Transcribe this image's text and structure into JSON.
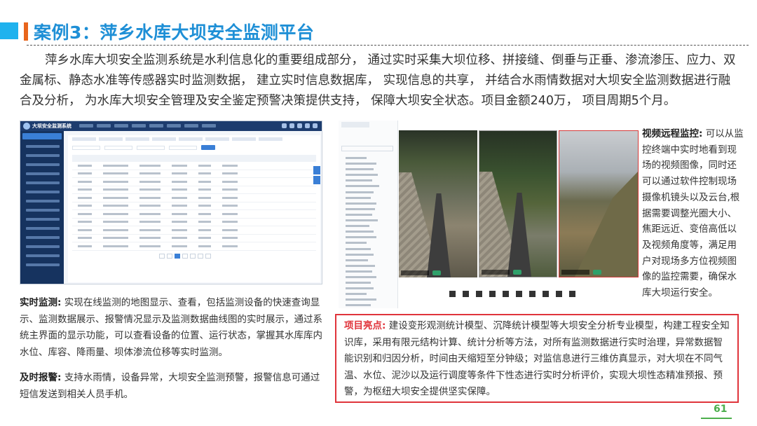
{
  "title": "案例3：萍乡水库大坝安全监测平台",
  "intro": "萍乡水库大坝安全监测系统是水利信息化的重要组成部分， 通过实时采集大坝位移、拼接缝、倒垂与正垂、渗流渗压、应力、双金属标、静态水准等传感器实时监测数据， 建立实时信息数据库， 实现信息的共享， 并结合水雨情数据对大坝安全监测数据进行融合及分析， 为水库大坝安全管理及安全鉴定预警决策提供支持， 保障大坝安全状态。项目金额240万， 项目周期5个月。",
  "dashboard": {
    "title": "大坝安全监测系统"
  },
  "video_remote": {
    "label": "视频远程监控:",
    "text": "可以从监控终端中实时地看到现场的视频图像，同时还可以通过软件控制现场摄像机镜头以及云台,根据需要调整光圈大小、焦距远近、变倍高低以及视频角度等，满足用户对现场多方位视频图像的监控需要，确保水库大坝运行安全。"
  },
  "realtime_monitoring": {
    "label": "实时监测:",
    "text": "实现在线监测的地图显示、查看，包括监测设备的快速查询显示、监测数据展示、报警情况显示及监测数据曲线图的实时展示，通过系统主界面的显示功能，可以查看设备的位置、运行状态，掌握其水库库内水位、库容、降雨量、坝体渗流位移等实时监测。"
  },
  "timely_alarm": {
    "label": "及时报警:",
    "text": "支持水雨情，设备异常，大坝安全监测预警，报警信息可通过短信发送到相关人员手机。"
  },
  "highlights": {
    "label": "项目亮点:",
    "text": "建设变形观测统计模型、沉降统计模型等大坝安全分析专业模型，构建工程安全知识库，采用有限元结构计算、统计分析等方法，对所有监测数据进行实时治理，异常数据智能识别和归因分析，时间由天缩短至分钟级；对监信息进行三维仿真显示，对大坝在不同气温、水位、泥沙以及运行调度等条件下性态进行实时分析评价，实现大坝性态精准预报、预警，为枢纽大坝安全提供坚实保障。"
  },
  "page_number": "61",
  "colors": {
    "title": "#1e8fd6",
    "accent_orange": "#e8651c",
    "accent_blue": "#1fb2ee",
    "highlight_border": "#e0343b",
    "page_number": "#4cae4c"
  }
}
